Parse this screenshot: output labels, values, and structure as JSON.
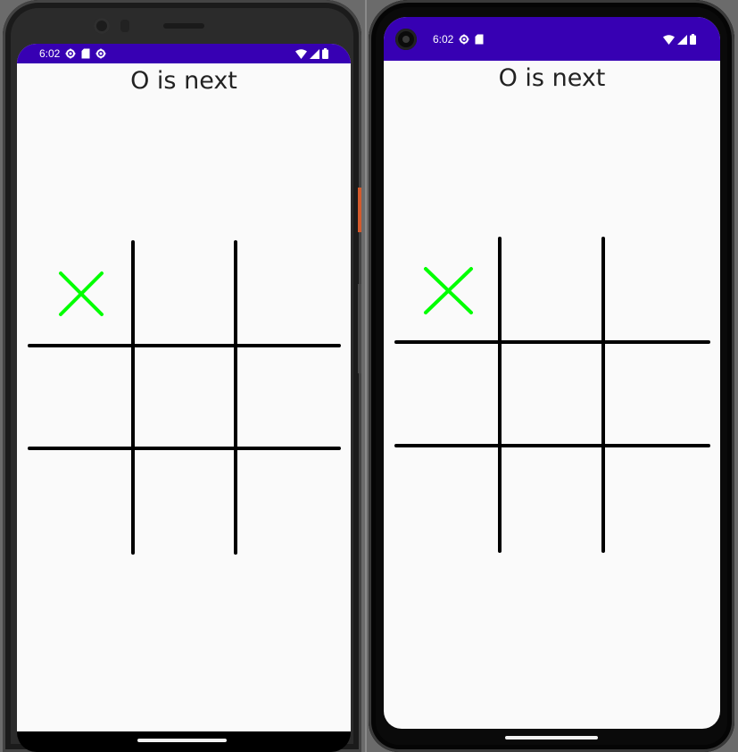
{
  "left_phone": {
    "status": {
      "time": "6:02",
      "left_icons": [
        "settings-icon",
        "sd-card-icon",
        "settings-icon"
      ],
      "right_icons": [
        "wifi-icon",
        "signal-icon",
        "battery-icon"
      ]
    },
    "game": {
      "status_text": "O is next",
      "cells": [
        "X",
        "",
        "",
        "",
        "",
        "",
        "",
        "",
        ""
      ]
    }
  },
  "right_phone": {
    "status": {
      "time": "6:02",
      "left_icons": [
        "settings-icon",
        "sd-card-icon"
      ],
      "right_icons": [
        "wifi-icon",
        "signal-icon",
        "battery-icon"
      ]
    },
    "game": {
      "status_text": "O is next",
      "cells": [
        "X",
        "",
        "",
        "",
        "",
        "",
        "",
        "",
        ""
      ]
    }
  },
  "colors": {
    "status_bar": "#3700b3",
    "x_mark": "#00ff00",
    "grid_line": "#000000",
    "screen_bg": "#fafafa"
  }
}
